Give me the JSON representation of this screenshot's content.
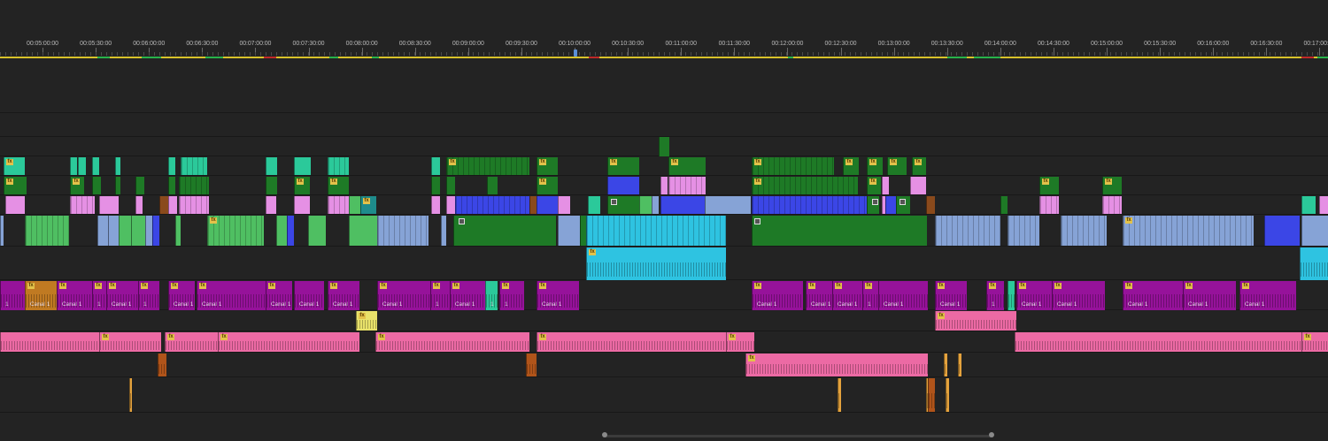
{
  "timeline": {
    "ruler": {
      "timecodes": [
        "00:05:00:00",
        "00:05:30:00",
        "00:06:00:00",
        "00:06:30:00",
        "00:07:00:00",
        "00:07:30:00",
        "00:08:00:00",
        "00:08:30:00",
        "00:09:00:00",
        "00:09:30:00",
        "00:10:00:00",
        "00:10:30:00",
        "00:11:00:00",
        "00:11:30:00",
        "00:12:00:00",
        "00:12:30:00",
        "00:13:00:00",
        "00:13:30:00",
        "00:14:00:00",
        "00:14:30:00",
        "00:15:00:00",
        "00:15:30:00",
        "00:16:00:00",
        "00:16:30:00",
        "00:17:00:00"
      ]
    },
    "badges": {
      "fx": "fx"
    },
    "audio_clip_label": "Canal 1",
    "audio_clip_short_label": "1",
    "colors": {
      "video_green": "#1e7a26",
      "video_teal": "#2bc99a",
      "video_pink": "#e590e4",
      "video_blue": "#3b46e6",
      "video_lightgreen": "#4fbf62",
      "video_steelblue": "#86a3d6",
      "video_cyan": "#2ec3e1",
      "audio_magenta": "#96129a",
      "audio_pink": "#ec6aa4",
      "audio_yellow": "#e8e16a",
      "audio_orange": "#e4a23d",
      "render_yellow": "#d8c22a",
      "render_green": "#27b34a",
      "render_red": "#c02828",
      "playhead": "#5b8fd6"
    }
  }
}
